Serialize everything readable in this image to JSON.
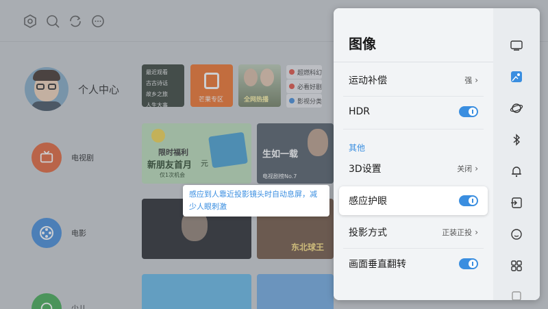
{
  "background": {
    "top_icons": [
      "settings-hex-icon",
      "search-icon",
      "refresh-icon",
      "message-icon"
    ],
    "sidebar": [
      {
        "label": "个人中心",
        "icon": "avatar"
      },
      {
        "label": "电视剧",
        "icon": "tv-icon",
        "color": "#e25d2e"
      },
      {
        "label": "电影",
        "icon": "film-reel-icon",
        "color": "#3b86d8"
      },
      {
        "label": "少儿",
        "icon": "gamepad-icon",
        "color": "#3aa64b"
      }
    ],
    "tiles": {
      "history_list": [
        "最近观看",
        "古古诗话",
        "故乡之旅",
        "人生大事"
      ],
      "mango_label": "芒果专区",
      "hot_label": "全网热播",
      "menu_chips": [
        "超燃科幻",
        "必看好剧",
        "影视分类"
      ],
      "promo_line1": "限时福利",
      "promo_line2": "新朋友首月",
      "promo_price": "元",
      "promo_sub": "仅1次机会",
      "drama_title": "生如一载",
      "drama_rank": "电视剧榜No.7",
      "movie_title": "东北球王"
    }
  },
  "panel": {
    "title": "图像",
    "rows": [
      {
        "label": "运动补偿",
        "value": "强",
        "type": "select"
      },
      {
        "label": "HDR",
        "type": "toggle",
        "on": true
      }
    ],
    "section": "其他",
    "rows2": [
      {
        "label": "3D设置",
        "value": "关闭",
        "type": "select"
      },
      {
        "label": "感应护眼",
        "type": "toggle",
        "on": true,
        "focused": true
      },
      {
        "label": "投影方式",
        "value": "正装正投",
        "type": "select"
      },
      {
        "label": "画面垂直翻转",
        "type": "toggle",
        "on": true
      }
    ],
    "rail_icons": [
      "display-icon",
      "image-icon",
      "planet-icon",
      "bluetooth-icon",
      "bell-icon",
      "input-source-icon",
      "face-icon",
      "apps-grid-icon",
      "more-icon"
    ],
    "accent": "#3a8ee0"
  },
  "tooltip": {
    "text": "感应到人靠近投影镜头时自动息屏，减少人眼刺激"
  }
}
